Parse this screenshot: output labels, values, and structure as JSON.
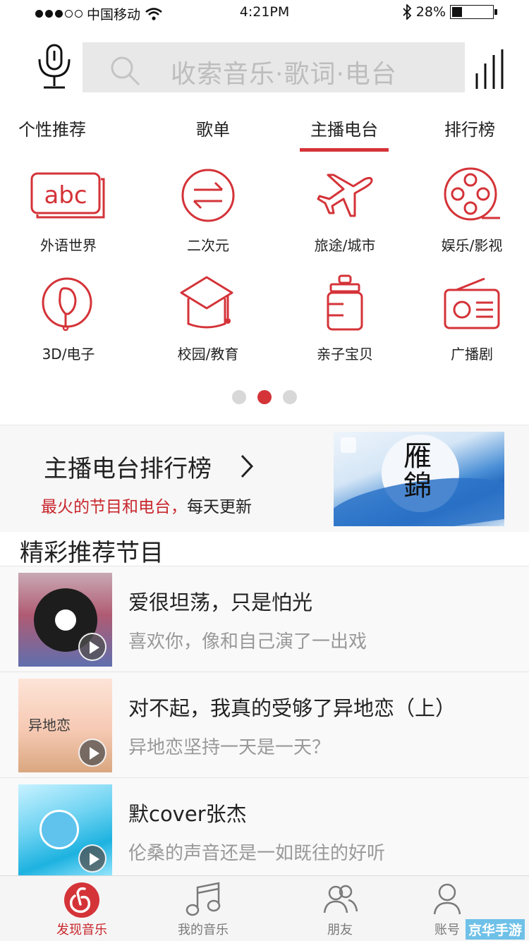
{
  "status_bar": {
    "carrier": "中国移动",
    "time": "4:21PM",
    "battery": "28%",
    "battery_level": 0.28,
    "signal_dots": 5,
    "signal_filled": 3
  },
  "header": {
    "search_placeholder": "收索音乐·歌词·电台",
    "icons": [
      "mic-icon",
      "search-icon",
      "equalizer-icon"
    ]
  },
  "tabs": [
    {
      "label": "个性推荐",
      "active": false
    },
    {
      "label": "歌单",
      "active": false
    },
    {
      "label": "主播电台",
      "active": true
    },
    {
      "label": "排行榜",
      "active": false
    }
  ],
  "categories": [
    {
      "label": "外语世界",
      "icon": "abc-icon"
    },
    {
      "label": "二次元",
      "icon": "swap-arrows-icon"
    },
    {
      "label": "旅途/城市",
      "icon": "airplane-icon"
    },
    {
      "label": "娱乐/影视",
      "icon": "film-reel-icon"
    },
    {
      "label": "3D/电子",
      "icon": "electronic-icon"
    },
    {
      "label": "校园/教育",
      "icon": "graduation-cap-icon"
    },
    {
      "label": "亲子宝贝",
      "icon": "baby-bottle-icon"
    },
    {
      "label": "广播剧",
      "icon": "radio-icon"
    }
  ],
  "pager": {
    "pages": 3,
    "active": 2
  },
  "rank_banner": {
    "title": "主播电台排行榜",
    "sub_red": "最火的节目和电台，",
    "sub_black": "每天更新",
    "image_text": "雁錦"
  },
  "section": {
    "title": "精彩推荐节目"
  },
  "programs": [
    {
      "title": "爱很坦荡，只是怕光",
      "subtitle": "喜欢你，像和自己演了一出戏"
    },
    {
      "title": "对不起，我真的受够了异地恋（上）",
      "subtitle": "异地恋坚持一天是一天？",
      "cover_text": "异地恋"
    },
    {
      "title": "默cover张杰",
      "subtitle": "伦桑的声音还是一如既往的好听"
    }
  ],
  "bottom_nav": [
    {
      "label": "发现音乐",
      "icon": "netease-music-icon",
      "active": true
    },
    {
      "label": "我的音乐",
      "icon": "music-note-icon",
      "active": false
    },
    {
      "label": "朋友",
      "icon": "friends-icon",
      "active": false
    },
    {
      "label": "账号",
      "icon": "account-icon",
      "active": false
    }
  ],
  "watermark": "京华手游",
  "colors": {
    "accent": "#d43338",
    "text": "#222222",
    "muted": "#999999"
  }
}
